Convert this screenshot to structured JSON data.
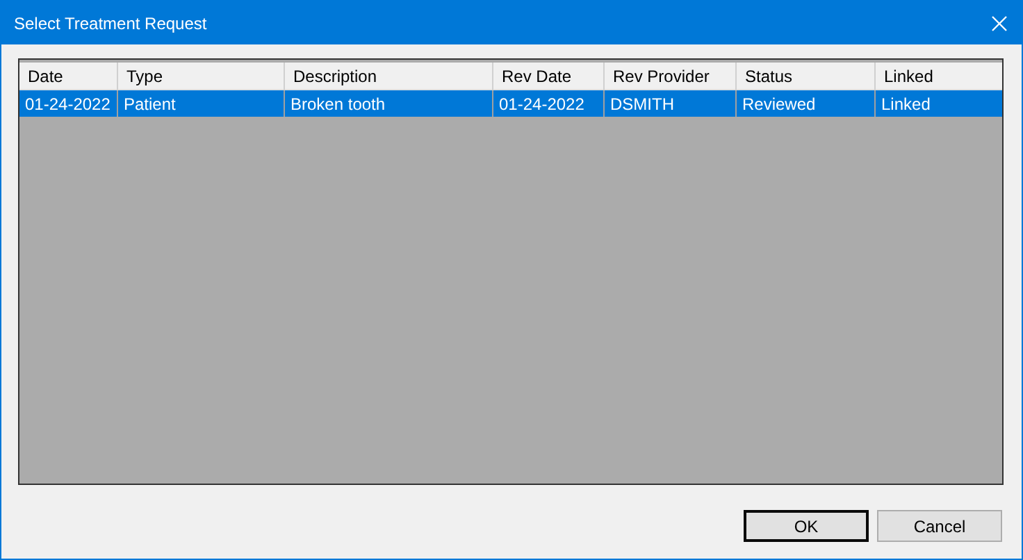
{
  "window": {
    "title": "Select Treatment Request"
  },
  "table": {
    "columns": [
      "Date",
      "Type",
      "Description",
      "Rev Date",
      "Rev Provider",
      "Status",
      "Linked"
    ],
    "rows": [
      {
        "cells": [
          "01-24-2022",
          "Patient",
          "Broken tooth",
          "01-24-2022",
          "DSMITH",
          "Reviewed",
          "Linked"
        ],
        "selected": true
      }
    ]
  },
  "buttons": [
    {
      "label": "OK",
      "default": true
    },
    {
      "label": "Cancel",
      "default": false
    }
  ]
}
